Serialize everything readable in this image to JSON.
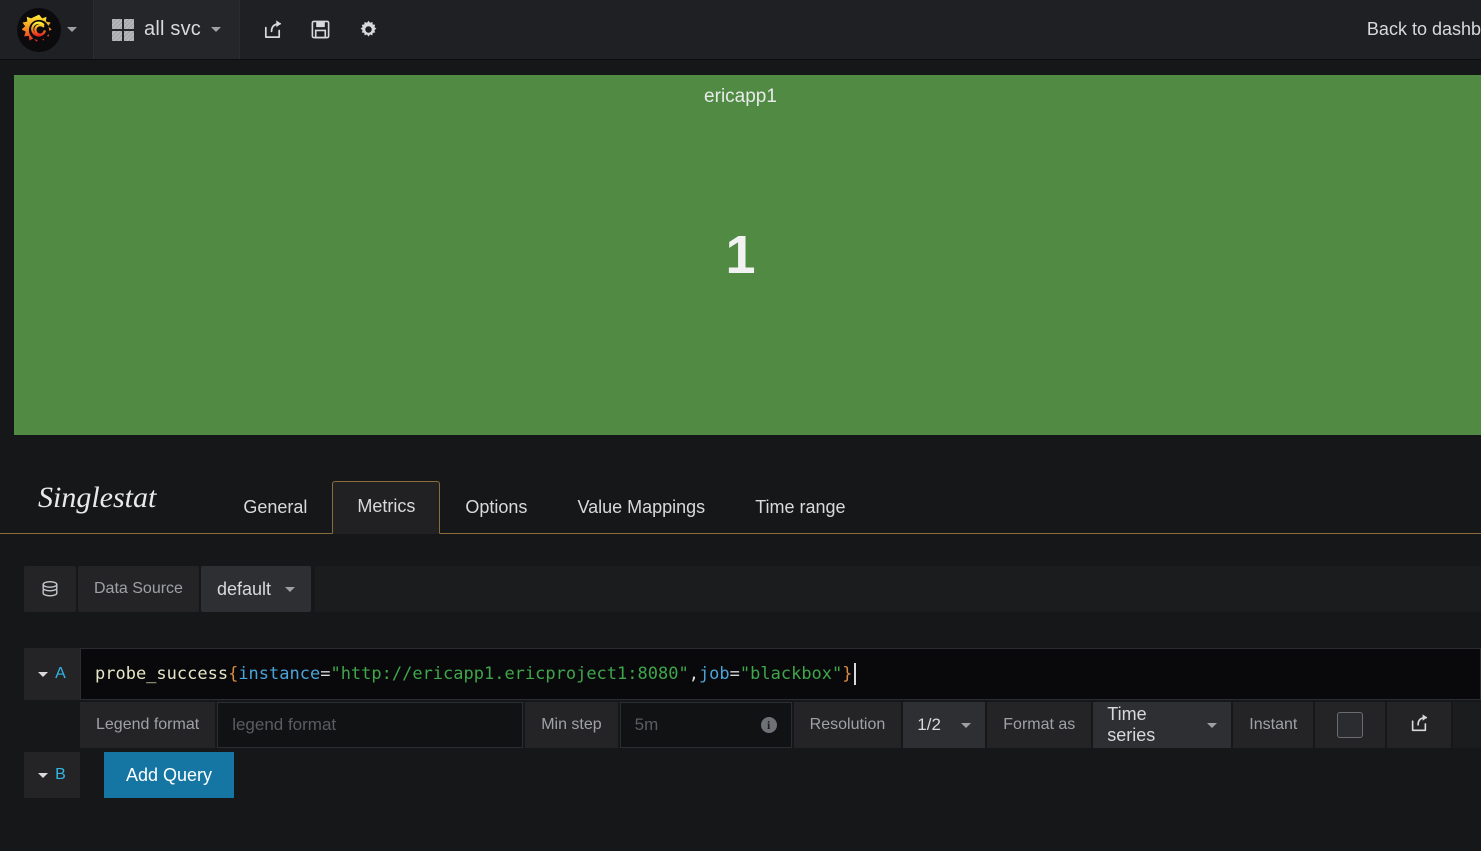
{
  "navbar": {
    "logo_icon": "grafana-logo-icon",
    "logo_caret_icon": "chevron-down-icon",
    "dashboard_icon": "dashboard-grid-icon",
    "dashboard_title": "all svc",
    "dashboard_caret_icon": "chevron-down-icon",
    "icons": [
      {
        "name": "share-icon",
        "glyph": "share"
      },
      {
        "name": "save-icon",
        "glyph": "save"
      },
      {
        "name": "gear-icon",
        "glyph": "gear"
      }
    ],
    "back_link": "Back to dashb"
  },
  "panel": {
    "title": "ericapp1",
    "value": "1",
    "background_color": "#508a43",
    "value_color": "#f2f2f2"
  },
  "editor": {
    "panel_type": "Singlestat",
    "tabs": [
      {
        "label": "General",
        "active": false
      },
      {
        "label": "Metrics",
        "active": true
      },
      {
        "label": "Options",
        "active": false
      },
      {
        "label": "Value Mappings",
        "active": false
      },
      {
        "label": "Time range",
        "active": false
      }
    ],
    "active_tab_border_color": "#8a6d3b"
  },
  "datasource_row": {
    "db_icon": "database-icon",
    "label": "Data Source",
    "selected": "default",
    "caret_icon": "chevron-down-icon"
  },
  "query_a": {
    "letter": "A",
    "collapse_icon": "chevron-down-icon",
    "expression_tokens": [
      {
        "text": "probe_success",
        "type": "metric"
      },
      {
        "text": "{",
        "type": "brace"
      },
      {
        "text": "instance",
        "type": "label"
      },
      {
        "text": "=",
        "type": "op"
      },
      {
        "text": "\"http://ericapp1.ericproject1:8080\"",
        "type": "str"
      },
      {
        "text": ",",
        "type": "comma"
      },
      {
        "text": "job",
        "type": "label"
      },
      {
        "text": "=",
        "type": "op"
      },
      {
        "text": "\"blackbox\"",
        "type": "str"
      },
      {
        "text": "}",
        "type": "brace"
      }
    ],
    "expression_plain": "probe_success{instance=\"http://ericapp1.ericproject1:8080\",job=\"blackbox\"}"
  },
  "query_options": {
    "legend_format_label": "Legend format",
    "legend_format_value": "",
    "legend_format_placeholder": "legend format",
    "min_step_label": "Min step",
    "min_step_value": "",
    "min_step_placeholder": "5m",
    "min_step_info_icon": "info-icon",
    "resolution_label": "Resolution",
    "resolution_value": "1/2",
    "resolution_caret_icon": "chevron-down-icon",
    "format_as_label": "Format as",
    "format_as_value": "Time series",
    "format_as_caret_icon": "chevron-down-icon",
    "instant_label": "Instant",
    "instant_checked": false,
    "external_link_icon": "external-link-icon"
  },
  "query_b": {
    "letter": "B",
    "collapse_icon": "chevron-down-icon",
    "add_query_label": "Add Query"
  }
}
